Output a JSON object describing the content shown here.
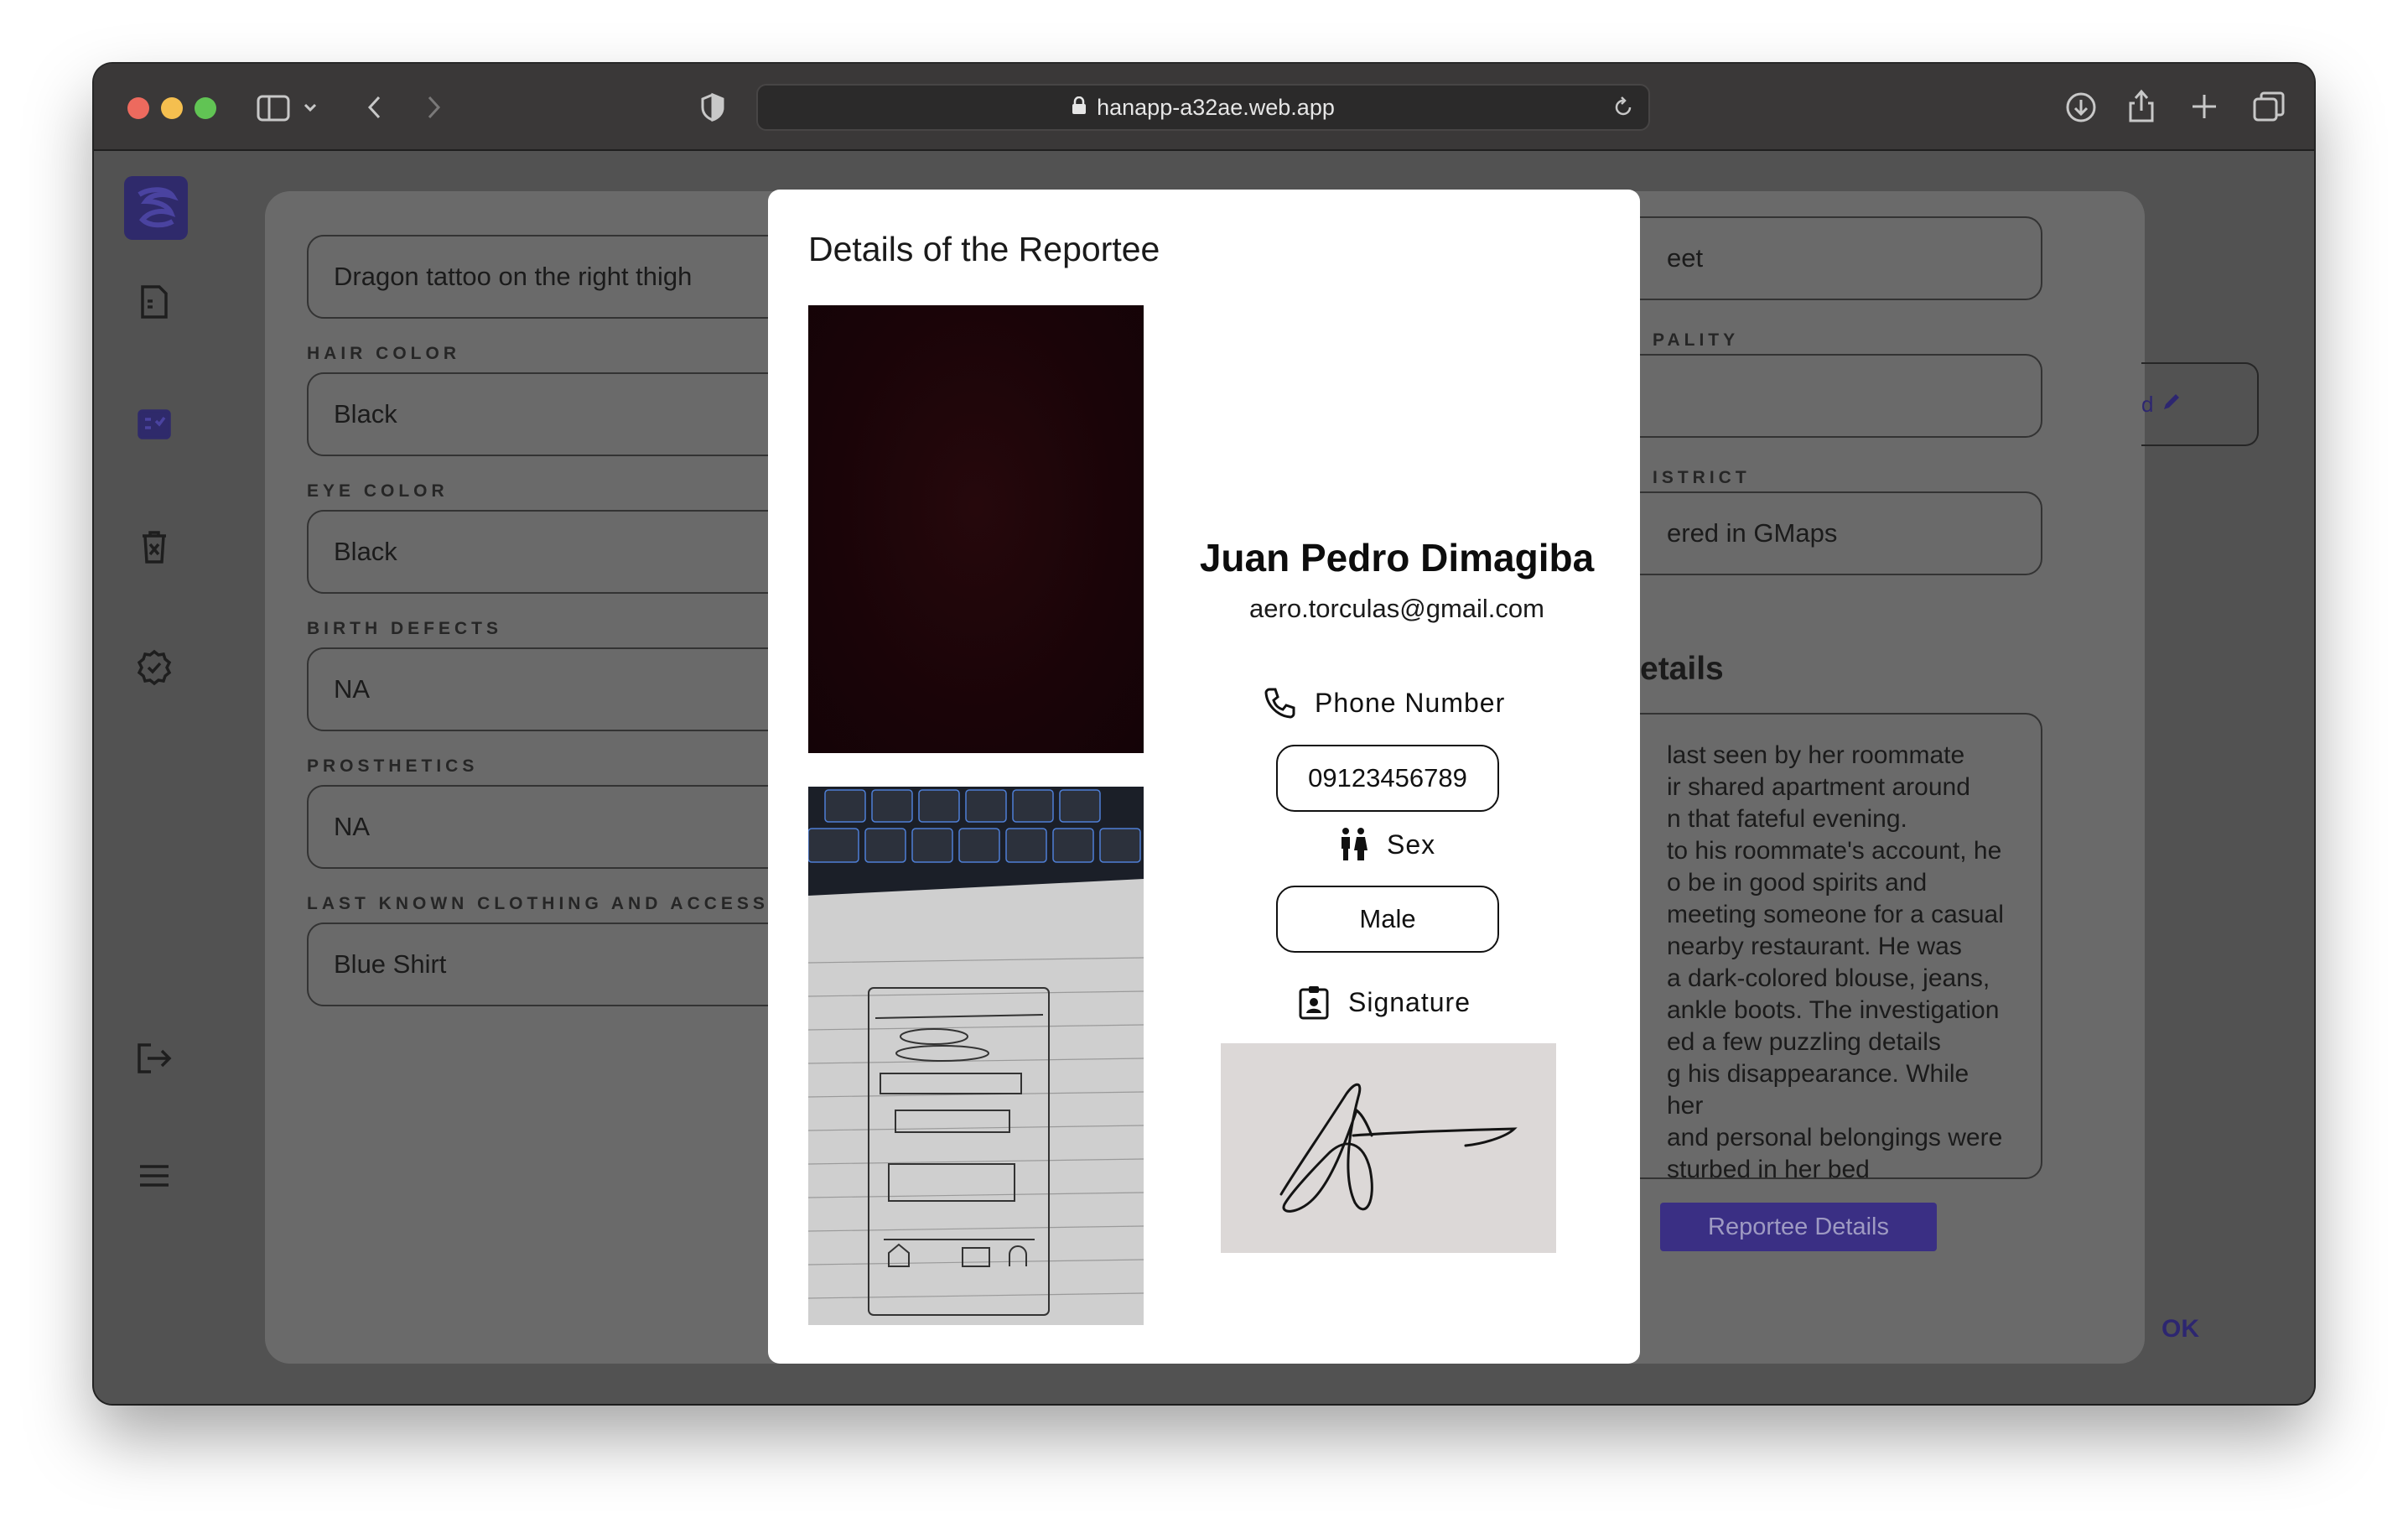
{
  "browser": {
    "url": "hanapp-a32ae.web.app"
  },
  "left_fields": [
    {
      "label": "",
      "value": "Dragon tattoo on the right thigh"
    },
    {
      "label": "HAIR COLOR",
      "value": "Black"
    },
    {
      "label": "EYE COLOR",
      "value": "Black"
    },
    {
      "label": "BIRTH DEFECTS",
      "value": "NA"
    },
    {
      "label": "PROSTHETICS",
      "value": "NA"
    },
    {
      "label": "LAST KNOWN CLOTHING AND ACCESS",
      "value": "Blue Shirt"
    }
  ],
  "right_fields": [
    {
      "label": "",
      "value": "eet"
    },
    {
      "label": "PALITY",
      "value": ""
    },
    {
      "label": "ISTRICT",
      "value": "ered in GMaps"
    }
  ],
  "details": {
    "heading": "etails",
    "lines": [
      "last seen by her roommate",
      "ir shared apartment around",
      "n that fateful evening.",
      "to his roommate's account, he",
      "o be in good spirits and",
      "meeting someone for a casual",
      "nearby restaurant. He was",
      "a dark-colored blouse, jeans,",
      "ankle boots. The investigation",
      "ed a few puzzling details",
      "g his disappearance. While her",
      "and personal belongings were",
      "sturbed in her bed"
    ]
  },
  "buttons": {
    "reportee_details": "Reportee Details",
    "ok": "OK",
    "edit_partial": "d"
  },
  "modal": {
    "title": "Details of the Reportee",
    "name": "Juan Pedro Dimagiba",
    "email": "aero.torculas@gmail.com",
    "phone_label": "Phone Number",
    "phone_value": "09123456789",
    "sex_label": "Sex",
    "sex_value": "Male",
    "signature_label": "Signature"
  },
  "colors": {
    "accent": "#3a2f84",
    "logo": "#2f2a6b"
  }
}
